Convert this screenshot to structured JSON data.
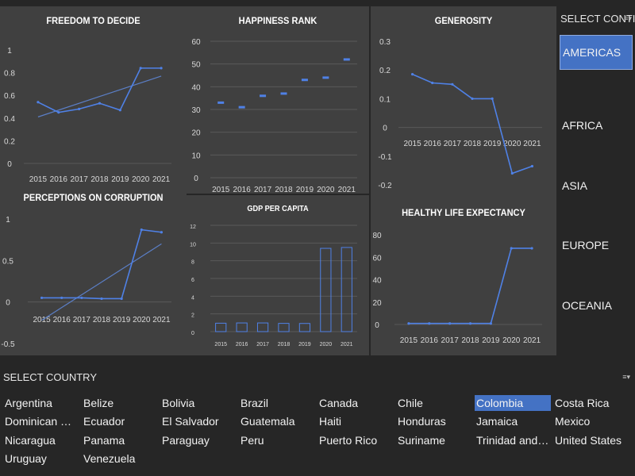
{
  "chart_data": [
    {
      "type": "line",
      "title": "FREEDOM TO DECIDE",
      "x": [
        "2015",
        "2016",
        "2017",
        "2018",
        "2019",
        "2020",
        "2021"
      ],
      "series": [
        {
          "values": [
            0.54,
            0.45,
            0.48,
            0.53,
            0.47,
            0.84,
            0.84
          ]
        }
      ],
      "trendline": [
        0.41,
        0.77
      ],
      "ylim": [
        0,
        1
      ],
      "yticks": [
        "0",
        "0.2",
        "0.4",
        "0.6",
        "0.8",
        "1"
      ],
      "grid": false
    },
    {
      "type": "scatter",
      "title": "HAPPINESS RANK",
      "x": [
        "2015",
        "2016",
        "2017",
        "2018",
        "2019",
        "2020",
        "2021"
      ],
      "series": [
        {
          "values": [
            33,
            31,
            36,
            37,
            43,
            44,
            52
          ]
        }
      ],
      "ylim": [
        0,
        60
      ],
      "yticks": [
        "0",
        "10",
        "20",
        "30",
        "40",
        "50",
        "60"
      ],
      "grid": true
    },
    {
      "type": "line",
      "title": "GENEROSITY",
      "x": [
        "2015",
        "2016",
        "2017",
        "2018",
        "2019",
        "2020",
        "2021"
      ],
      "series": [
        {
          "values": [
            0.185,
            0.155,
            0.15,
            0.1,
            0.1,
            -0.16,
            -0.135
          ]
        }
      ],
      "ylim": [
        -0.2,
        0.3
      ],
      "yticks": [
        "-0.2",
        "-0.1",
        "0",
        "0.1",
        "0.2",
        "0.3"
      ],
      "grid": false
    },
    {
      "type": "line",
      "title": "PERCEPTIONS ON CORRUPTION",
      "x": [
        "2015",
        "2016",
        "2017",
        "2018",
        "2019",
        "2020",
        "2021"
      ],
      "series": [
        {
          "values": [
            0.05,
            0.05,
            0.05,
            0.04,
            0.04,
            0.87,
            0.84
          ]
        }
      ],
      "trendline": [
        -0.22,
        0.7
      ],
      "ylim": [
        -0.5,
        1
      ],
      "yticks": [
        "-0.5",
        "0",
        "0.5",
        "1"
      ],
      "grid": false
    },
    {
      "type": "bar",
      "title": "GDP PER CAPITA",
      "categories": [
        "2015",
        "2016",
        "2017",
        "2018",
        "2019",
        "2020",
        "2021"
      ],
      "values": [
        0.95,
        0.98,
        0.98,
        0.93,
        0.92,
        9.4,
        9.5
      ],
      "ylim": [
        0,
        12
      ],
      "yticks": [
        "0",
        "2",
        "4",
        "6",
        "8",
        "10",
        "12"
      ],
      "grid": true
    },
    {
      "type": "line",
      "title": "HEALTHY LIFE EXPECTANCY",
      "x": [
        "2015",
        "2016",
        "2017",
        "2018",
        "2019",
        "2020",
        "2021"
      ],
      "series": [
        {
          "values": [
            0.9,
            0.9,
            0.9,
            0.9,
            0.9,
            68,
            68
          ]
        }
      ],
      "ylim": [
        0,
        80
      ],
      "yticks": [
        "0",
        "20",
        "40",
        "60",
        "80"
      ],
      "grid": false
    }
  ],
  "continent_slicer": {
    "header": "SELECT CONTI...",
    "items": [
      "AMERICAS",
      "AFRICA",
      "ASIA",
      "EUROPE",
      "OCEANIA"
    ],
    "selected": "AMERICAS"
  },
  "country_slicer": {
    "header": "SELECT COUNTRY",
    "items": [
      "Argentina",
      "Belize",
      "Bolivia",
      "Brazil",
      "Canada",
      "Chile",
      "Colombia",
      "Costa Rica",
      "Dominican Repu...",
      "Ecuador",
      "El Salvador",
      "Guatemala",
      "Haiti",
      "Honduras",
      "Jamaica",
      "Mexico",
      "Nicaragua",
      "Panama",
      "Paraguay",
      "Peru",
      "Puerto Rico",
      "Suriname",
      "Trinidad and To...",
      "United States",
      "Uruguay",
      "Venezuela"
    ],
    "selected": "Colombia"
  },
  "colors": {
    "accent": "#4472c4",
    "line": "#4f81e6",
    "panel": "#404040",
    "background": "#262626"
  }
}
